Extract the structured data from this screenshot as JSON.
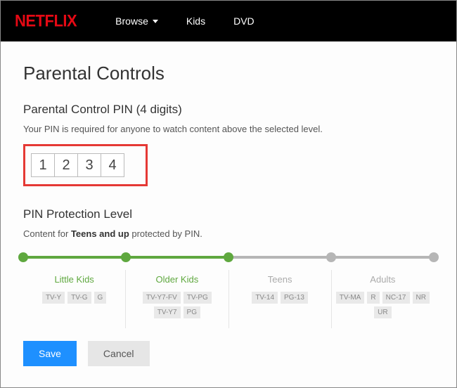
{
  "logo": "NETFLIX",
  "nav": {
    "browse": "Browse",
    "kids": "Kids",
    "dvd": "DVD"
  },
  "page": {
    "title": "Parental Controls",
    "pin_heading": "Parental Control PIN (4 digits)",
    "pin_desc": "Your PIN is required for anyone to watch content above the selected level.",
    "pin": [
      "1",
      "2",
      "3",
      "4"
    ],
    "level_heading": "PIN Protection Level",
    "protect_prefix": "Content for ",
    "protect_bold": "Teens and up",
    "protect_suffix": " protected by PIN."
  },
  "levels": [
    {
      "name": "Little Kids",
      "active": true,
      "ratings": [
        "TV-Y",
        "TV-G",
        "G"
      ]
    },
    {
      "name": "Older Kids",
      "active": true,
      "ratings": [
        "TV-Y7-FV",
        "TV-PG",
        "TV-Y7",
        "PG"
      ]
    },
    {
      "name": "Teens",
      "active": false,
      "ratings": [
        "TV-14",
        "PG-13"
      ]
    },
    {
      "name": "Adults",
      "active": false,
      "ratings": [
        "TV-MA",
        "R",
        "NC-17",
        "NR",
        "UR"
      ]
    }
  ],
  "slider": {
    "fill_percent": 50,
    "stops": [
      0,
      25,
      50,
      75,
      100
    ],
    "active_until": 50
  },
  "buttons": {
    "save": "Save",
    "cancel": "Cancel"
  }
}
